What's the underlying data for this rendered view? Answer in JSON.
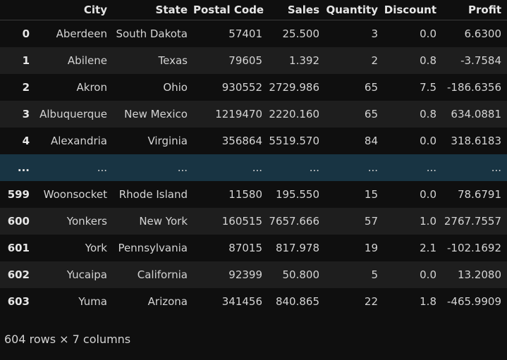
{
  "table": {
    "index_header": "",
    "columns": [
      "City",
      "State",
      "Postal Code",
      "Sales",
      "Quantity",
      "Discount",
      "Profit"
    ],
    "rows": [
      {
        "index": "0",
        "cells": [
          "Aberdeen",
          "South Dakota",
          "57401",
          "25.500",
          "3",
          "0.0",
          "6.6300"
        ],
        "type": "odd"
      },
      {
        "index": "1",
        "cells": [
          "Abilene",
          "Texas",
          "79605",
          "1.392",
          "2",
          "0.8",
          "-3.7584"
        ],
        "type": "even"
      },
      {
        "index": "2",
        "cells": [
          "Akron",
          "Ohio",
          "930552",
          "2729.986",
          "65",
          "7.5",
          "-186.6356"
        ],
        "type": "odd"
      },
      {
        "index": "3",
        "cells": [
          "Albuquerque",
          "New Mexico",
          "1219470",
          "2220.160",
          "65",
          "0.8",
          "634.0881"
        ],
        "type": "even"
      },
      {
        "index": "4",
        "cells": [
          "Alexandria",
          "Virginia",
          "356864",
          "5519.570",
          "84",
          "0.0",
          "318.6183"
        ],
        "type": "odd"
      },
      {
        "index": "...",
        "cells": [
          "...",
          "...",
          "...",
          "...",
          "...",
          "...",
          "..."
        ],
        "type": "ellipsis"
      },
      {
        "index": "599",
        "cells": [
          "Woonsocket",
          "Rhode Island",
          "11580",
          "195.550",
          "15",
          "0.0",
          "78.6791"
        ],
        "type": "odd"
      },
      {
        "index": "600",
        "cells": [
          "Yonkers",
          "New York",
          "160515",
          "7657.666",
          "57",
          "1.0",
          "2767.7557"
        ],
        "type": "even"
      },
      {
        "index": "601",
        "cells": [
          "York",
          "Pennsylvania",
          "87015",
          "817.978",
          "19",
          "2.1",
          "-102.1692"
        ],
        "type": "odd"
      },
      {
        "index": "602",
        "cells": [
          "Yucaipa",
          "California",
          "92399",
          "50.800",
          "5",
          "0.0",
          "13.2080"
        ],
        "type": "even"
      },
      {
        "index": "603",
        "cells": [
          "Yuma",
          "Arizona",
          "341456",
          "840.865",
          "22",
          "1.8",
          "-465.9909"
        ],
        "type": "odd"
      }
    ]
  },
  "footer": {
    "text": "604 rows × 7 columns"
  },
  "colors": {
    "background": "#0f0f0f",
    "stripe": "#1e1e1e",
    "ellipsis_row": "#183443",
    "text": "#d4d4d4"
  }
}
